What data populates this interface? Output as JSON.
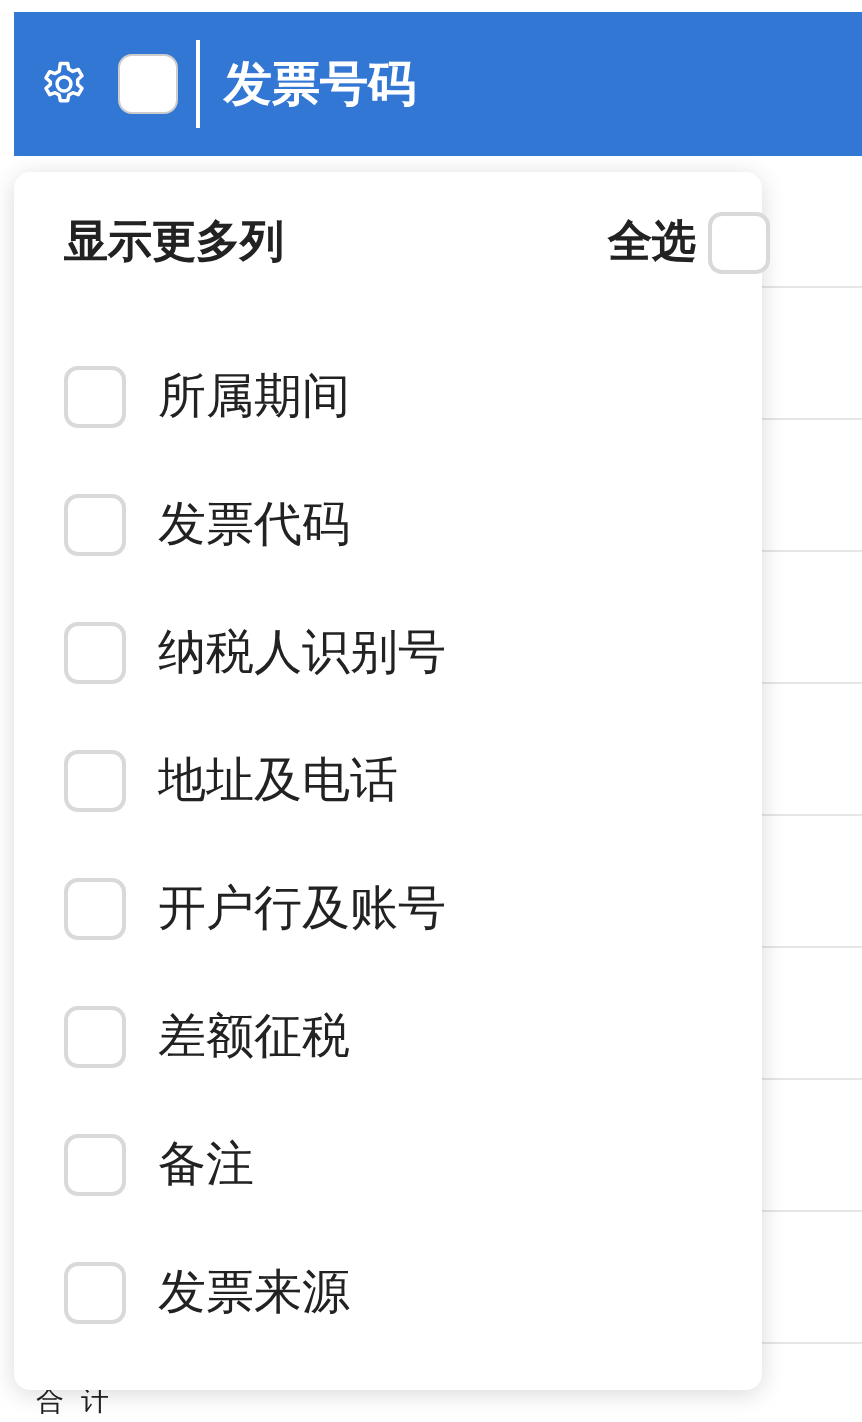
{
  "header": {
    "checked": false,
    "title": "发票号码"
  },
  "column_menu": {
    "title": "显示更多列",
    "select_all": {
      "label": "全选",
      "checked": false
    },
    "columns": [
      {
        "label": "所属期间",
        "checked": false
      },
      {
        "label": "发票代码",
        "checked": false
      },
      {
        "label": "纳税人识别号",
        "checked": false
      },
      {
        "label": "地址及电话",
        "checked": false
      },
      {
        "label": "开户行及账号",
        "checked": false
      },
      {
        "label": "差额征税",
        "checked": false
      },
      {
        "label": "备注",
        "checked": false
      },
      {
        "label": "发票来源",
        "checked": false
      }
    ]
  },
  "footer": {
    "label": "合 计"
  }
}
